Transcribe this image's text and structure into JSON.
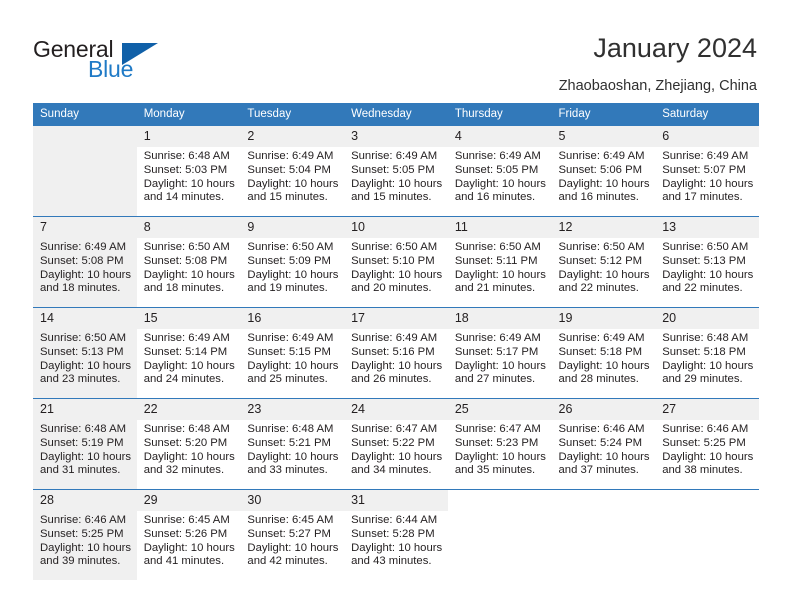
{
  "brand": {
    "name_part1": "General",
    "name_part2": "Blue",
    "triangle_color": "#1060a8",
    "blue_color": "#1f7ac6"
  },
  "header": {
    "title": "January 2024",
    "subtitle": "Zhaobaoshan, Zhejiang, China"
  },
  "theme": {
    "header_row_bg": "#3279ba",
    "daynum_bg": "#f0f0f0",
    "text_color": "#231f20"
  },
  "weekday_headers": [
    "Sunday",
    "Monday",
    "Tuesday",
    "Wednesday",
    "Thursday",
    "Friday",
    "Saturday"
  ],
  "weeks": [
    [
      {
        "day": "",
        "sunrise": "",
        "sunset": "",
        "daylight1": "",
        "daylight2": ""
      },
      {
        "day": "1",
        "sunrise": "Sunrise: 6:48 AM",
        "sunset": "Sunset: 5:03 PM",
        "daylight1": "Daylight: 10 hours",
        "daylight2": "and 14 minutes."
      },
      {
        "day": "2",
        "sunrise": "Sunrise: 6:49 AM",
        "sunset": "Sunset: 5:04 PM",
        "daylight1": "Daylight: 10 hours",
        "daylight2": "and 15 minutes."
      },
      {
        "day": "3",
        "sunrise": "Sunrise: 6:49 AM",
        "sunset": "Sunset: 5:05 PM",
        "daylight1": "Daylight: 10 hours",
        "daylight2": "and 15 minutes."
      },
      {
        "day": "4",
        "sunrise": "Sunrise: 6:49 AM",
        "sunset": "Sunset: 5:05 PM",
        "daylight1": "Daylight: 10 hours",
        "daylight2": "and 16 minutes."
      },
      {
        "day": "5",
        "sunrise": "Sunrise: 6:49 AM",
        "sunset": "Sunset: 5:06 PM",
        "daylight1": "Daylight: 10 hours",
        "daylight2": "and 16 minutes."
      },
      {
        "day": "6",
        "sunrise": "Sunrise: 6:49 AM",
        "sunset": "Sunset: 5:07 PM",
        "daylight1": "Daylight: 10 hours",
        "daylight2": "and 17 minutes."
      }
    ],
    [
      {
        "day": "7",
        "sunrise": "Sunrise: 6:49 AM",
        "sunset": "Sunset: 5:08 PM",
        "daylight1": "Daylight: 10 hours",
        "daylight2": "and 18 minutes."
      },
      {
        "day": "8",
        "sunrise": "Sunrise: 6:50 AM",
        "sunset": "Sunset: 5:08 PM",
        "daylight1": "Daylight: 10 hours",
        "daylight2": "and 18 minutes."
      },
      {
        "day": "9",
        "sunrise": "Sunrise: 6:50 AM",
        "sunset": "Sunset: 5:09 PM",
        "daylight1": "Daylight: 10 hours",
        "daylight2": "and 19 minutes."
      },
      {
        "day": "10",
        "sunrise": "Sunrise: 6:50 AM",
        "sunset": "Sunset: 5:10 PM",
        "daylight1": "Daylight: 10 hours",
        "daylight2": "and 20 minutes."
      },
      {
        "day": "11",
        "sunrise": "Sunrise: 6:50 AM",
        "sunset": "Sunset: 5:11 PM",
        "daylight1": "Daylight: 10 hours",
        "daylight2": "and 21 minutes."
      },
      {
        "day": "12",
        "sunrise": "Sunrise: 6:50 AM",
        "sunset": "Sunset: 5:12 PM",
        "daylight1": "Daylight: 10 hours",
        "daylight2": "and 22 minutes."
      },
      {
        "day": "13",
        "sunrise": "Sunrise: 6:50 AM",
        "sunset": "Sunset: 5:13 PM",
        "daylight1": "Daylight: 10 hours",
        "daylight2": "and 22 minutes."
      }
    ],
    [
      {
        "day": "14",
        "sunrise": "Sunrise: 6:50 AM",
        "sunset": "Sunset: 5:13 PM",
        "daylight1": "Daylight: 10 hours",
        "daylight2": "and 23 minutes."
      },
      {
        "day": "15",
        "sunrise": "Sunrise: 6:49 AM",
        "sunset": "Sunset: 5:14 PM",
        "daylight1": "Daylight: 10 hours",
        "daylight2": "and 24 minutes."
      },
      {
        "day": "16",
        "sunrise": "Sunrise: 6:49 AM",
        "sunset": "Sunset: 5:15 PM",
        "daylight1": "Daylight: 10 hours",
        "daylight2": "and 25 minutes."
      },
      {
        "day": "17",
        "sunrise": "Sunrise: 6:49 AM",
        "sunset": "Sunset: 5:16 PM",
        "daylight1": "Daylight: 10 hours",
        "daylight2": "and 26 minutes."
      },
      {
        "day": "18",
        "sunrise": "Sunrise: 6:49 AM",
        "sunset": "Sunset: 5:17 PM",
        "daylight1": "Daylight: 10 hours",
        "daylight2": "and 27 minutes."
      },
      {
        "day": "19",
        "sunrise": "Sunrise: 6:49 AM",
        "sunset": "Sunset: 5:18 PM",
        "daylight1": "Daylight: 10 hours",
        "daylight2": "and 28 minutes."
      },
      {
        "day": "20",
        "sunrise": "Sunrise: 6:48 AM",
        "sunset": "Sunset: 5:18 PM",
        "daylight1": "Daylight: 10 hours",
        "daylight2": "and 29 minutes."
      }
    ],
    [
      {
        "day": "21",
        "sunrise": "Sunrise: 6:48 AM",
        "sunset": "Sunset: 5:19 PM",
        "daylight1": "Daylight: 10 hours",
        "daylight2": "and 31 minutes."
      },
      {
        "day": "22",
        "sunrise": "Sunrise: 6:48 AM",
        "sunset": "Sunset: 5:20 PM",
        "daylight1": "Daylight: 10 hours",
        "daylight2": "and 32 minutes."
      },
      {
        "day": "23",
        "sunrise": "Sunrise: 6:48 AM",
        "sunset": "Sunset: 5:21 PM",
        "daylight1": "Daylight: 10 hours",
        "daylight2": "and 33 minutes."
      },
      {
        "day": "24",
        "sunrise": "Sunrise: 6:47 AM",
        "sunset": "Sunset: 5:22 PM",
        "daylight1": "Daylight: 10 hours",
        "daylight2": "and 34 minutes."
      },
      {
        "day": "25",
        "sunrise": "Sunrise: 6:47 AM",
        "sunset": "Sunset: 5:23 PM",
        "daylight1": "Daylight: 10 hours",
        "daylight2": "and 35 minutes."
      },
      {
        "day": "26",
        "sunrise": "Sunrise: 6:46 AM",
        "sunset": "Sunset: 5:24 PM",
        "daylight1": "Daylight: 10 hours",
        "daylight2": "and 37 minutes."
      },
      {
        "day": "27",
        "sunrise": "Sunrise: 6:46 AM",
        "sunset": "Sunset: 5:25 PM",
        "daylight1": "Daylight: 10 hours",
        "daylight2": "and 38 minutes."
      }
    ],
    [
      {
        "day": "28",
        "sunrise": "Sunrise: 6:46 AM",
        "sunset": "Sunset: 5:25 PM",
        "daylight1": "Daylight: 10 hours",
        "daylight2": "and 39 minutes."
      },
      {
        "day": "29",
        "sunrise": "Sunrise: 6:45 AM",
        "sunset": "Sunset: 5:26 PM",
        "daylight1": "Daylight: 10 hours",
        "daylight2": "and 41 minutes."
      },
      {
        "day": "30",
        "sunrise": "Sunrise: 6:45 AM",
        "sunset": "Sunset: 5:27 PM",
        "daylight1": "Daylight: 10 hours",
        "daylight2": "and 42 minutes."
      },
      {
        "day": "31",
        "sunrise": "Sunrise: 6:44 AM",
        "sunset": "Sunset: 5:28 PM",
        "daylight1": "Daylight: 10 hours",
        "daylight2": "and 43 minutes."
      },
      {
        "day": "",
        "sunrise": "",
        "sunset": "",
        "daylight1": "",
        "daylight2": ""
      },
      {
        "day": "",
        "sunrise": "",
        "sunset": "",
        "daylight1": "",
        "daylight2": ""
      },
      {
        "day": "",
        "sunrise": "",
        "sunset": "",
        "daylight1": "",
        "daylight2": ""
      }
    ]
  ]
}
